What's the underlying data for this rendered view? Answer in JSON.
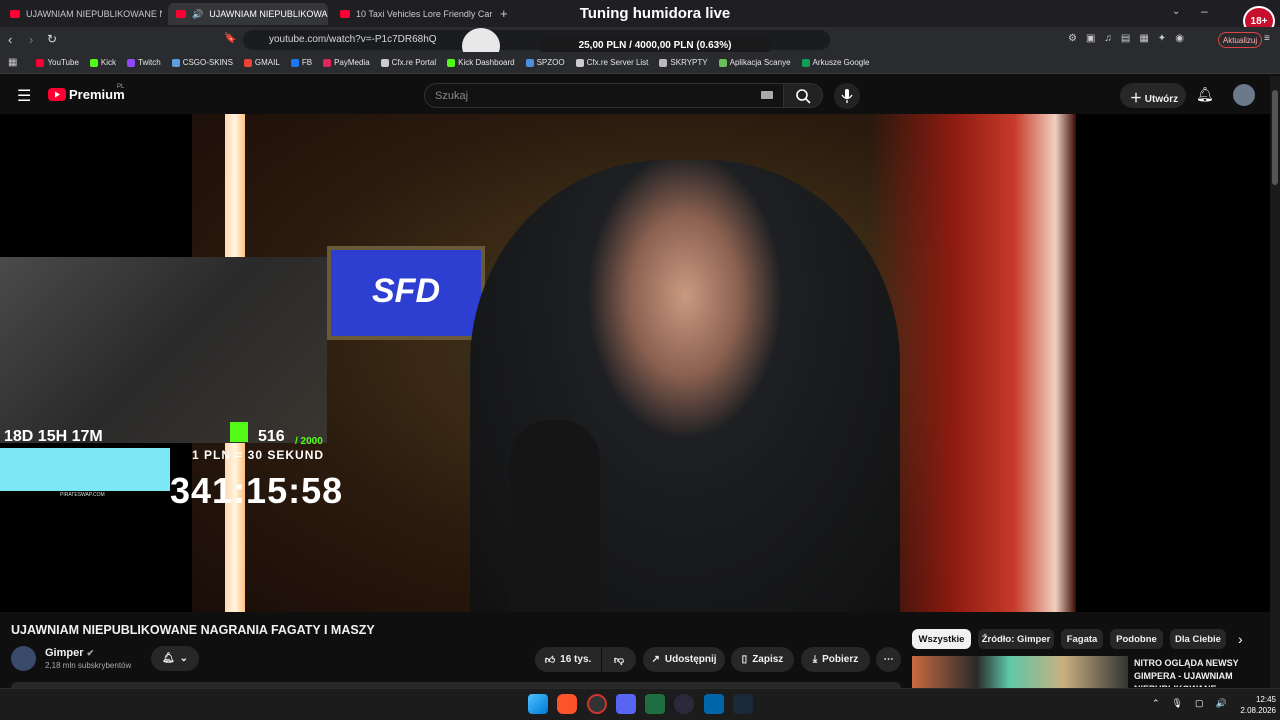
{
  "browser": {
    "tabs": [
      {
        "label": "UJAWNIAM NIEPUBLIKOWANE NAGR",
        "active": false
      },
      {
        "label": "UJAWNIAM NIEPUBLIKOWAN",
        "active": true
      },
      {
        "label": "10 Taxi Vehicles Lore Friendly Cars GT",
        "active": false
      }
    ],
    "url": "youtube.com/watch?v=-P1c7DR68hQ",
    "update_label": "Aktualizuj",
    "bookmarks": [
      {
        "label": "YouTube",
        "color": "#ff0033"
      },
      {
        "label": "Kick",
        "color": "#53fc18"
      },
      {
        "label": "Twitch",
        "color": "#9146ff"
      },
      {
        "label": "CSGO-SKINS",
        "color": "#5aa0e0"
      },
      {
        "label": "GMAIL",
        "color": "#ea4335"
      },
      {
        "label": "FB",
        "color": "#1877f2"
      },
      {
        "label": "PayMedia",
        "color": "#e0245e"
      },
      {
        "label": "Cfx.re Portal",
        "color": "#cccccc"
      },
      {
        "label": "Kick Dashboard",
        "color": "#53fc18"
      },
      {
        "label": "SPZOO",
        "color": "#4a90e2"
      },
      {
        "label": "Cfx.re Server List",
        "color": "#cccccc"
      },
      {
        "label": "SKRYPTY",
        "color": "#bbbbbb"
      },
      {
        "label": "Aplikacja Scanye",
        "color": "#6bbf59"
      },
      {
        "label": "Arkusze Google",
        "color": "#0f9d58"
      }
    ]
  },
  "overlay": {
    "stream_title": "Tuning humidora live",
    "donation_goal": "25,00 PLN / 4000,00 PLN (0.63%)",
    "age_badge": "18+",
    "small_timer": "18D 15H 17M",
    "kick_count": "516",
    "kick_goal": "/ 2000",
    "rate": "1 PLN = 30 SEKUND",
    "big_timer": "341:15:58",
    "pirate_label": "PIRATESWAP.COM",
    "sfd_logo": "SFD"
  },
  "youtube": {
    "brand": "Premium",
    "region": "PL",
    "search_placeholder": "Szukaj",
    "create_label": "Utwórz",
    "video_title": "UJAWNIAM NIEPUBLIKOWANE NAGRANIA FAGATY I MASZY",
    "channel_name": "Gimper",
    "subscribers": "2,18 mln subskrybentów",
    "likes": "16 tys.",
    "share_label": "Udostępnij",
    "save_label": "Zapisz",
    "download_label": "Pobierz",
    "chips": [
      "Wszystkie",
      "Źródło: Gimper",
      "Fagata",
      "Podobne",
      "Dla Ciebie"
    ],
    "recommended": {
      "title": "NITRO OGLĄDA NEWSY GIMPERA - UJAWNIAM NIEPUBLIKOWANE"
    }
  },
  "taskbar": {
    "time": "12:45",
    "date": "2.08.2026"
  },
  "colors": {
    "yt_red": "#ff0033",
    "kick_green": "#53fc18",
    "background": "#0f0f0f"
  }
}
